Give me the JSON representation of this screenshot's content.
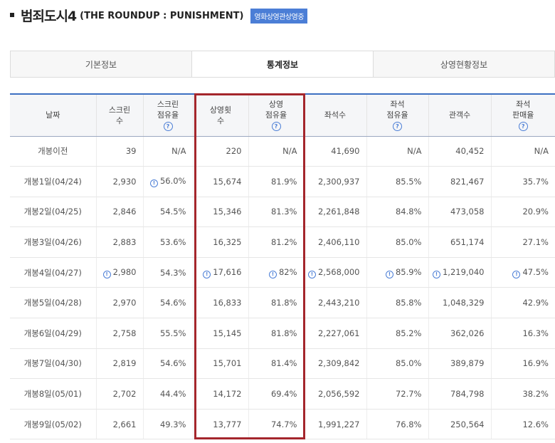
{
  "header": {
    "title_main": "범죄도시4",
    "title_sub": "(THE ROUNDUP : PUNISHMENT)",
    "badge": "영화상영관상영중"
  },
  "tabs": [
    {
      "label": "기본정보",
      "active": false
    },
    {
      "label": "통계정보",
      "active": true
    },
    {
      "label": "상영현황정보",
      "active": false
    }
  ],
  "columns": [
    {
      "lines": [
        "날짜"
      ],
      "help": false
    },
    {
      "lines": [
        "스크린",
        "수"
      ],
      "help": false
    },
    {
      "lines": [
        "스크린",
        "점유율"
      ],
      "help": true
    },
    {
      "lines": [
        "상영횟",
        "수"
      ],
      "help": false
    },
    {
      "lines": [
        "상영",
        "점유율"
      ],
      "help": true
    },
    {
      "lines": [
        "좌석수"
      ],
      "help": false
    },
    {
      "lines": [
        "좌석",
        "점유율"
      ],
      "help": true
    },
    {
      "lines": [
        "관객수"
      ],
      "help": false
    },
    {
      "lines": [
        "좌석",
        "판매율"
      ],
      "help": true
    }
  ],
  "help_glyph": "?",
  "alert_glyph": "!",
  "rows": [
    {
      "cells": [
        "개봉이전",
        "39",
        "N/A",
        "220",
        "N/A",
        "41,690",
        "N/A",
        "40,452",
        "N/A"
      ],
      "flags": []
    },
    {
      "cells": [
        "개봉1일(04/24)",
        "2,930",
        "56.0%",
        "15,674",
        "81.9%",
        "2,300,937",
        "85.5%",
        "821,467",
        "35.7%"
      ],
      "flags": [
        2
      ]
    },
    {
      "cells": [
        "개봉2일(04/25)",
        "2,846",
        "54.5%",
        "15,346",
        "81.3%",
        "2,261,848",
        "84.8%",
        "473,058",
        "20.9%"
      ],
      "flags": []
    },
    {
      "cells": [
        "개봉3일(04/26)",
        "2,883",
        "53.6%",
        "16,325",
        "81.2%",
        "2,406,110",
        "85.0%",
        "651,174",
        "27.1%"
      ],
      "flags": []
    },
    {
      "cells": [
        "개봉4일(04/27)",
        "2,980",
        "54.3%",
        "17,616",
        "82%",
        "2,568,000",
        "85.9%",
        "1,219,040",
        "47.5%"
      ],
      "flags": [
        1,
        3,
        4,
        5,
        6,
        7,
        8
      ]
    },
    {
      "cells": [
        "개봉5일(04/28)",
        "2,970",
        "54.6%",
        "16,833",
        "81.8%",
        "2,443,210",
        "85.8%",
        "1,048,329",
        "42.9%"
      ],
      "flags": []
    },
    {
      "cells": [
        "개봉6일(04/29)",
        "2,758",
        "55.5%",
        "15,145",
        "81.8%",
        "2,227,061",
        "85.2%",
        "362,026",
        "16.3%"
      ],
      "flags": []
    },
    {
      "cells": [
        "개봉7일(04/30)",
        "2,819",
        "54.6%",
        "15,701",
        "81.4%",
        "2,309,842",
        "85.0%",
        "389,879",
        "16.9%"
      ],
      "flags": []
    },
    {
      "cells": [
        "개봉8일(05/01)",
        "2,702",
        "44.4%",
        "14,172",
        "69.4%",
        "2,056,592",
        "72.7%",
        "784,798",
        "38.2%"
      ],
      "flags": []
    },
    {
      "cells": [
        "개봉9일(05/02)",
        "2,661",
        "49.3%",
        "13,777",
        "74.7%",
        "1,991,227",
        "76.8%",
        "250,564",
        "12.6%"
      ],
      "flags": []
    }
  ],
  "colors": {
    "accent": "#4b7ed6",
    "highlight_box": "#a4262c",
    "header_rule": "#3d6fc2"
  }
}
